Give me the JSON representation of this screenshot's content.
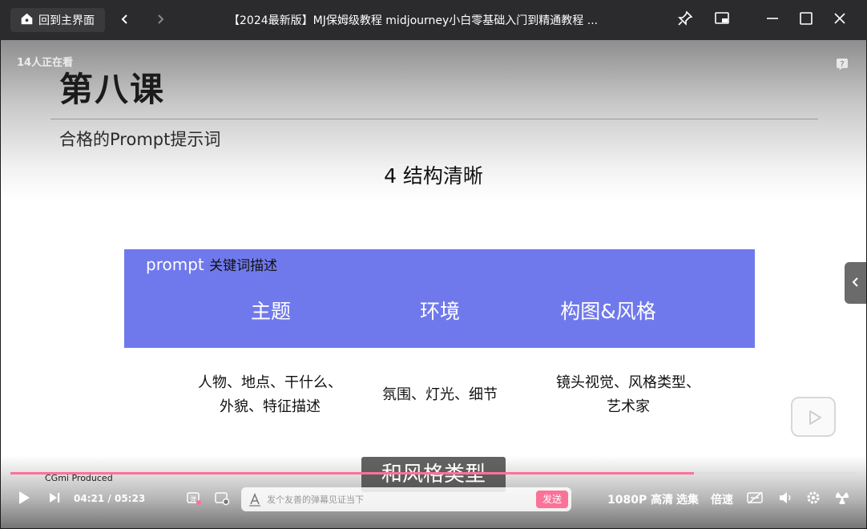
{
  "titlebar": {
    "home_label": "回到主界面",
    "title": "【2024最新版】MJ保姆级教程 midjourney小白零基础入门到精通教程 ..."
  },
  "video": {
    "viewers": "14人正在看",
    "slide": {
      "lesson_title": "第八课",
      "subtitle": "合格的Prompt提示词",
      "heading": "4 结构清晰",
      "box_label_prefix": "prompt",
      "box_label_keyword": "关键词描述",
      "categories": [
        "主题",
        "环境",
        "构图&风格"
      ],
      "descriptions": {
        "subject_line1": "人物、地点、干什么、",
        "subject_line2": "外貌、特征描述",
        "environment": "氛围、灯光、细节",
        "style_line1": "镜头视觉、风格类型、",
        "style_line2": "艺术家"
      }
    },
    "caption": "和风格类型",
    "produced": "CGmi Produced",
    "progress": 0.808
  },
  "controls": {
    "time_current": "04:21",
    "time_separator": "/",
    "time_total": "05:23",
    "danmaku_placeholder": "发个友善的弹幕见证当下",
    "send_label": "发送",
    "quality_label": "1080P 高清",
    "episodes_label": "选集",
    "speed_label": "倍速"
  },
  "colors": {
    "accent": "#fb7299",
    "box_blue": "#7079ec"
  }
}
